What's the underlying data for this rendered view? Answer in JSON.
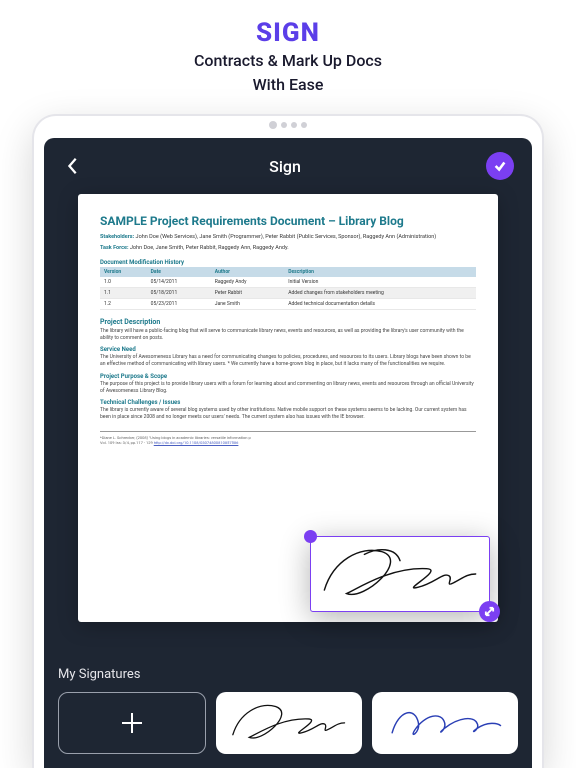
{
  "hero": {
    "title": "SIGN",
    "line1": "Contracts & Mark Up Docs",
    "line2": "With Ease"
  },
  "topbar": {
    "title": "Sign"
  },
  "document": {
    "title": "SAMPLE Project Requirements Document – Library Blog",
    "stakeholders_label": "Stakeholders:",
    "stakeholders": "John Doe (Web Services), Jane Smith (Programmer), Peter Rabbit (Public Services, Sponsor), Raggedy Ann (Administration)",
    "taskforce_label": "Task Force:",
    "taskforce": "John Doe, Jane Smith, Peter Rabbit, Raggedy Ann, Raggedy Andy.",
    "history_heading": "Document Modification History",
    "table": {
      "headers": [
        "Version",
        "Date",
        "Author",
        "Description"
      ],
      "rows": [
        [
          "1.0",
          "05/14/2011",
          "Raggedy Andy",
          "Initial Version"
        ],
        [
          "1.1",
          "05/18/2011",
          "Peter Rabbit",
          "Added changes from stakeholders meeting"
        ],
        [
          "1.2",
          "05/23/2011",
          "Jane Smith",
          "Added technical documentation details"
        ]
      ]
    },
    "sections": {
      "project_description": {
        "heading": "Project Description",
        "body": "The library will have a public-facing blog that will serve to communicate library news, events and resources, as well as providing the library's user community with the ability to comment on posts."
      },
      "service_need": {
        "heading": "Service Need",
        "body": "The University of Awesomeness Library has a need for communicating changes to policies, procedures, and resources to its users. Library blogs have been shown to be an effective method of communicating with library users. * We currently have a home-grown blog in place, but it lacks many of the functionalities we require."
      },
      "project_purpose": {
        "heading": "Project Purpose & Scope",
        "body": "The purpose of this project is to provide library users with a forum for learning about and commenting on library news, events and resources through an official University of Awesomeness Library Blog."
      },
      "tech_challenges": {
        "heading": "Technical Challenges / Issues",
        "body": "The library is currently aware of several blog systems used by other institutions. Native mobile support on these systems seems to be lacking. Our current system has been in place since 2008 and no longer meets our users' needs. The current system also has issues with the IE browser."
      }
    },
    "footnote": {
      "text": "*Diane L. Schrecker, (2008) \"Using blogs in academic libraries: versatile information p",
      "text2": "Vol. 109 Iss: 3/4, pp.117 - 129 ",
      "link": "http://dx.doi.org/10.1108/03074800810857586"
    }
  },
  "signatures": {
    "panel_title": "My Signatures",
    "items": [
      "signature-1",
      "signature-2"
    ]
  },
  "colors": {
    "accent": "#7b3ff2",
    "hero_accent": "#5b3ee8",
    "dark": "#1e2633",
    "teal": "#1e7a8c"
  }
}
